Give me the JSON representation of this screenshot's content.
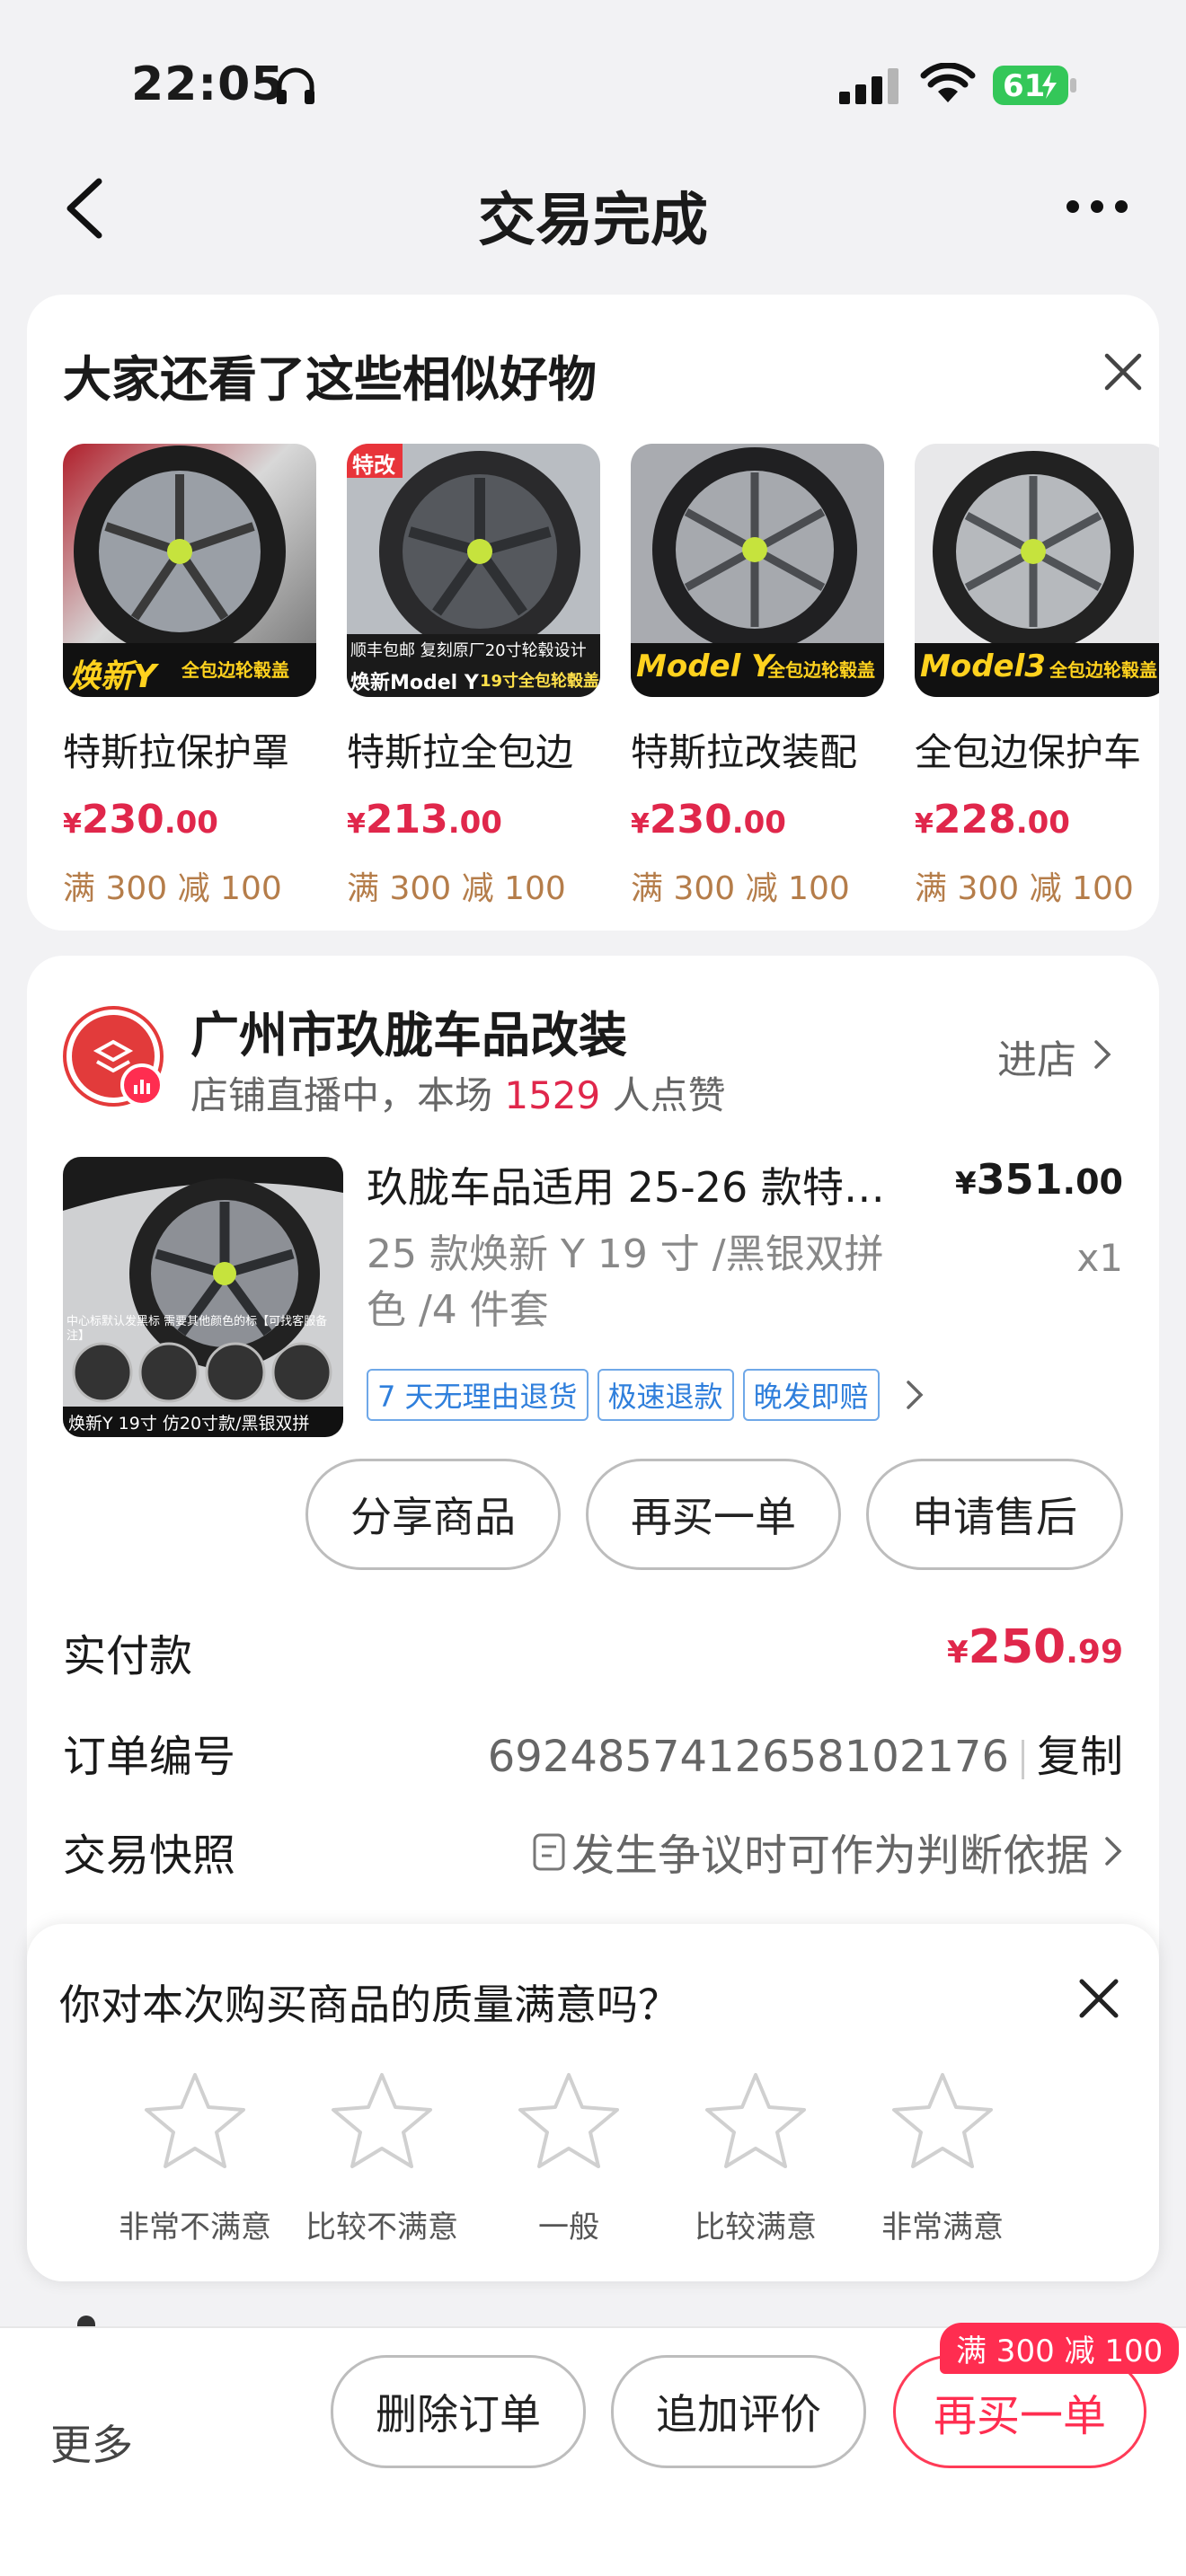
{
  "status": {
    "time": "22:05",
    "battery": "61"
  },
  "nav": {
    "title": "交易完成"
  },
  "similar": {
    "title": "大家还看了这些相似好物",
    "items": [
      {
        "name": "特斯拉保护罩",
        "currency": "¥",
        "price_int": "230",
        "price_dec": ".00",
        "promo": "满 300 减 100",
        "img_banner": "焕新Y",
        "img_sub": "全包边轮毂盖",
        "img_tag": "",
        "img_top": ""
      },
      {
        "name": "特斯拉全包边",
        "currency": "¥",
        "price_int": "213",
        "price_dec": ".00",
        "promo": "满 300 减 100",
        "img_banner": "焕新Model Y",
        "img_sub": "19寸全包轮毂盖",
        "img_tag": "特改",
        "img_top": "顺丰包邮 复刻原厂20寸轮毂设计"
      },
      {
        "name": "特斯拉改装配",
        "currency": "¥",
        "price_int": "230",
        "price_dec": ".00",
        "promo": "满 300 减 100",
        "img_banner": "Model Y",
        "img_sub": "全包边轮毂盖",
        "img_tag": "",
        "img_top": ""
      },
      {
        "name": "全包边保护车",
        "currency": "¥",
        "price_int": "228",
        "price_dec": ".00",
        "promo": "满 300 减 100",
        "img_banner": "Model3",
        "img_sub": "全包边轮毂盖",
        "img_tag": "",
        "img_top": ""
      }
    ]
  },
  "shop": {
    "name": "广州市玖胧车品改装",
    "live_prefix": "店铺直播中，本场 ",
    "live_count": "1529",
    "live_suffix": " 人点赞",
    "enter": "进店"
  },
  "item": {
    "title": "玖胧车品适用 25-26 款特…",
    "currency": "¥",
    "price_int": "351",
    "price_dec": ".00",
    "spec": "25 款焕新 Y 19 寸 /黑银双拼色 /4 件套",
    "qty": "x1",
    "tags": [
      "7 天无理由退货",
      "极速退款",
      "晚发即赔"
    ],
    "img_caption": "焕新Y 19寸 仿20寸款/黑银双拼",
    "img_note": "中心标默认发黑标 需要其他颜色的标【可找客服备注】"
  },
  "actions": {
    "share": "分享商品",
    "rebuy": "再买一单",
    "after_sale": "申请售后"
  },
  "paid": {
    "label": "实付款",
    "currency": "¥",
    "int": "250",
    "dec": ".99"
  },
  "order_no": {
    "label": "订单编号",
    "value": "6924857412658102176",
    "copy": "复制"
  },
  "snapshot": {
    "label": "交易快照",
    "value": "发生争议时可作为判断依据"
  },
  "rating": {
    "question": "你对本次购买商品的质量满意吗？",
    "options": [
      "非常不满意",
      "比较不满意",
      "一般",
      "比较满意",
      "非常满意"
    ]
  },
  "bottom": {
    "more": "更多",
    "delete": "删除订单",
    "review": "追加评价",
    "buy_again": "再买一单",
    "promo": "满 300 减 100"
  },
  "colors": {
    "accent": "#e0274b",
    "promo": "#b57d4a",
    "tag_blue": "#2f7fdc"
  }
}
